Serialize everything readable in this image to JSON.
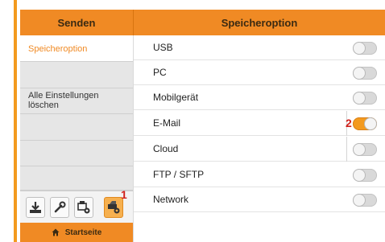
{
  "colors": {
    "accent": "#f08a24",
    "marker": "#d0201a"
  },
  "header": {
    "left_title": "Senden",
    "right_title": "Speicheroption"
  },
  "sidebar": {
    "items": [
      {
        "label": "Speicheroption",
        "active": true
      },
      {
        "label": ""
      },
      {
        "label": "Alle Einstellungen löschen"
      },
      {
        "label": ""
      },
      {
        "label": ""
      },
      {
        "label": ""
      }
    ]
  },
  "toolbar": {
    "buttons": [
      {
        "icon": "download-icon"
      },
      {
        "icon": "wrench-icon"
      },
      {
        "icon": "printer-gear-icon"
      },
      {
        "icon": "scanner-gear-icon",
        "selected": true
      }
    ],
    "marker": "1"
  },
  "home": {
    "label": "Startseite",
    "icon": "home-icon"
  },
  "options": [
    {
      "label": "USB",
      "on": false
    },
    {
      "label": "PC",
      "on": false
    },
    {
      "label": "Mobilgerät",
      "on": false
    },
    {
      "label": "E-Mail",
      "on": true,
      "marker": "2"
    },
    {
      "label": "Cloud",
      "on": false
    },
    {
      "label": "FTP / SFTP",
      "on": false
    },
    {
      "label": "Network",
      "on": false
    }
  ]
}
